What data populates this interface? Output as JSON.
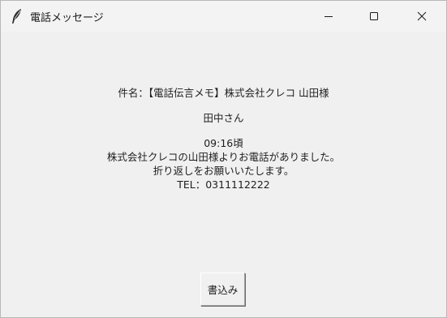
{
  "window": {
    "title": "電話メッセージ",
    "icon": "feather-icon"
  },
  "controls": {
    "minimize_icon": "minimize-icon",
    "maximize_icon": "maximize-icon",
    "close_icon": "close-icon"
  },
  "message": {
    "subject": "件名：【電話伝言メモ】株式会社クレコ 山田様",
    "recipient": "田中さん",
    "time": "09:16頃",
    "body_line1": "株式会社クレコの山田様よりお電話がありました。",
    "body_line2": "折り返しをお願いいたします。",
    "tel": "TEL：0311112222"
  },
  "buttons": {
    "write_label": "書込み"
  }
}
